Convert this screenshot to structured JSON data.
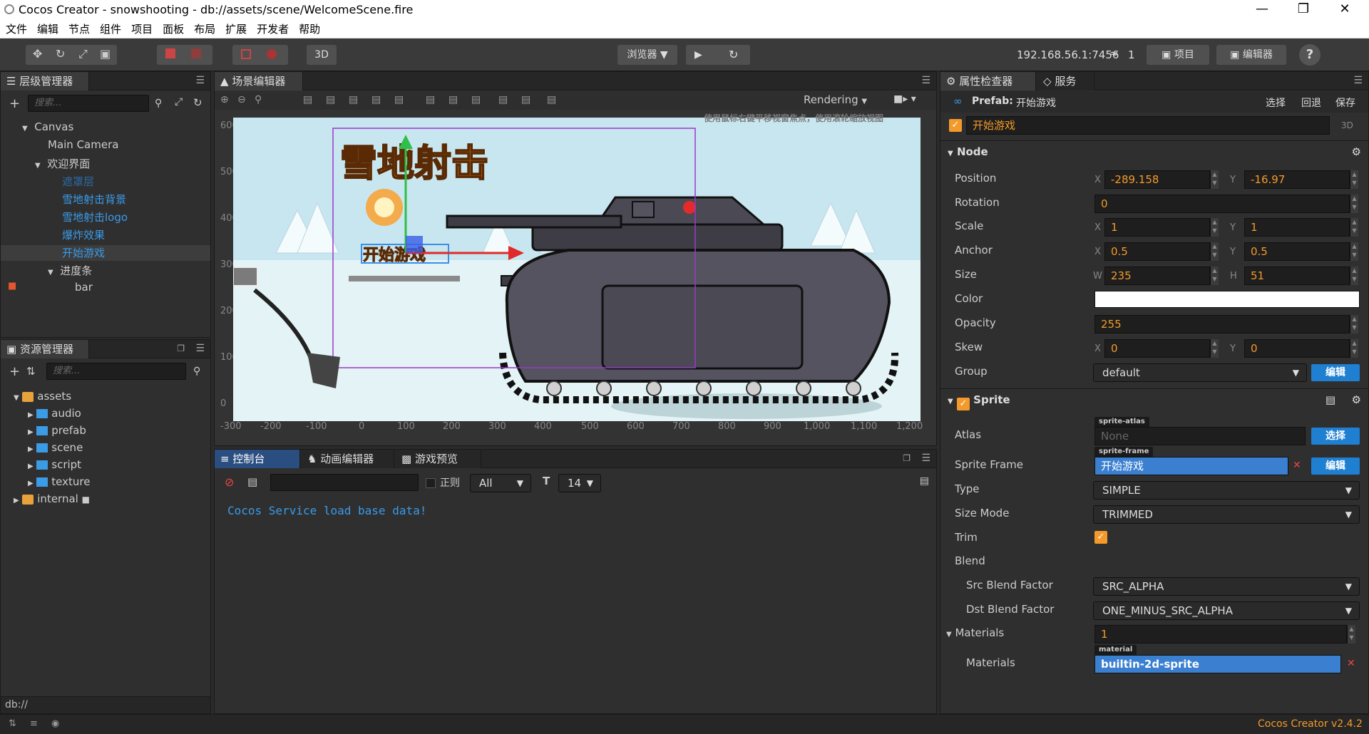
{
  "window": {
    "title": "Cocos Creator - snowshooting - db://assets/scene/WelcomeScene.fire"
  },
  "menu": [
    "文件",
    "编辑",
    "节点",
    "组件",
    "项目",
    "面板",
    "布局",
    "扩展",
    "开发者",
    "帮助"
  ],
  "toolbar": {
    "mode_3d": "3D",
    "browser": "浏览器",
    "ip": "192.168.56.1:7456",
    "wifi_count": "1",
    "project_btn": "项目",
    "editor_btn": "编辑器",
    "help": "?"
  },
  "hierarchy": {
    "tab": "层级管理器",
    "search_placeholder": "搜索...",
    "nodes": [
      "Canvas",
      "Main Camera",
      "欢迎界面",
      "遮罩层",
      "雪地射击背景",
      "雪地射击logo",
      "爆炸效果",
      "开始游戏",
      "进度条",
      "bar"
    ]
  },
  "assets": {
    "tab": "资源管理器",
    "search_placeholder": "搜索...",
    "items": [
      "assets",
      "audio",
      "prefab",
      "scene",
      "script",
      "texture",
      "internal"
    ],
    "footer": "db://"
  },
  "scene": {
    "tab": "场景编辑器",
    "rendering": "Rendering",
    "hint": "使用鼠标右键平移视窗焦点，使用滚轮缩放视图",
    "y_ticks": [
      "600",
      "500",
      "400",
      "300",
      "200",
      "100",
      "0"
    ],
    "x_ticks": [
      "-300",
      "-200",
      "-100",
      "0",
      "100",
      "200",
      "300",
      "400",
      "500",
      "600",
      "700",
      "800",
      "900",
      "1,000",
      "1,100",
      "1,200"
    ],
    "logo_text": "雪地射击",
    "button_text": "开始游戏"
  },
  "console": {
    "tabs": [
      "控制台",
      "动画编辑器",
      "游戏预览"
    ],
    "regex_label": "正则",
    "filter": "All",
    "font_size": "14",
    "log": "Cocos Service load base data!"
  },
  "inspector": {
    "tabs": [
      "属性检查器",
      "服务"
    ],
    "prefab_label": "Prefab:",
    "prefab_name": "开始游戏",
    "actions": [
      "选择",
      "回退",
      "保存"
    ],
    "node_name": "开始游戏",
    "badge_3d": "3D",
    "node_section": "Node",
    "position": {
      "label": "Position",
      "x": "-289.158",
      "y": "-16.97"
    },
    "rotation": {
      "label": "Rotation",
      "value": "0"
    },
    "scale": {
      "label": "Scale",
      "x": "1",
      "y": "1"
    },
    "anchor": {
      "label": "Anchor",
      "x": "0.5",
      "y": "0.5"
    },
    "size": {
      "label": "Size",
      "w": "235",
      "h": "51"
    },
    "color_label": "Color",
    "opacity": {
      "label": "Opacity",
      "value": "255"
    },
    "skew": {
      "label": "Skew",
      "x": "0",
      "y": "0"
    },
    "group": {
      "label": "Group",
      "value": "default",
      "btn": "编辑"
    },
    "sprite_section": "Sprite",
    "atlas": {
      "label": "Atlas",
      "tag": "sprite-atlas",
      "value": "None",
      "btn": "选择"
    },
    "sprite_frame": {
      "label": "Sprite Frame",
      "tag": "sprite-frame",
      "value": "开始游戏",
      "btn": "编辑"
    },
    "type": {
      "label": "Type",
      "value": "SIMPLE"
    },
    "size_mode": {
      "label": "Size Mode",
      "value": "TRIMMED"
    },
    "trim_label": "Trim",
    "blend_label": "Blend",
    "src_blend": {
      "label": "Src Blend Factor",
      "value": "SRC_ALPHA"
    },
    "dst_blend": {
      "label": "Dst Blend Factor",
      "value": "ONE_MINUS_SRC_ALPHA"
    },
    "materials_section": {
      "label": "Materials",
      "value": "1"
    },
    "material": {
      "label": "Materials",
      "tag": "material",
      "value": "builtin-2d-sprite"
    },
    "axis": {
      "x": "X",
      "y": "Y",
      "w": "W",
      "h": "H"
    }
  },
  "statusbar": {
    "version": "Cocos Creator v2.4.2"
  },
  "colors": {
    "accent": "#f49a2a",
    "blue_link": "#3a9bea",
    "button_blue": "#1f7fd1"
  }
}
